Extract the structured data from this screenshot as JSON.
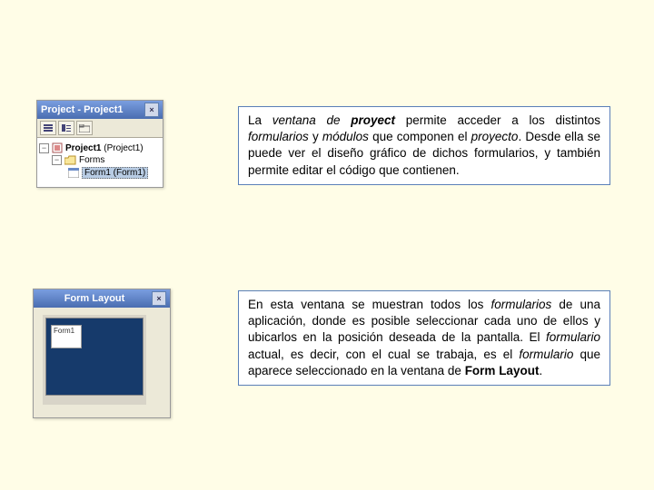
{
  "project_panel": {
    "title": "Project - Project1",
    "close_glyph": "×",
    "root_label_bold": "Project1",
    "root_label_suffix": " (Project1)",
    "folder_label": "Forms",
    "item_label": "Form1 (Form1)",
    "expander": "−"
  },
  "formlayout_panel": {
    "title": "Form Layout",
    "close_glyph": "×",
    "form_label": "Form1"
  },
  "desc1": {
    "t1": "La ",
    "t2": "ventana de ",
    "t3": "proyect",
    "t4": " permite acceder a los distintos ",
    "t5": "formularios",
    "t6": " y ",
    "t7": "módulos",
    "t8": " que componen el ",
    "t9": "proyecto",
    "t10": ". Desde ella se puede ver el diseño gráfico de dichos formularios, y también permite editar el código que contienen."
  },
  "desc2": {
    "t1": "En esta ventana se muestran todos los ",
    "t2": "formularios",
    "t3": " de una aplicación, donde es posible seleccionar cada uno de ellos y ubicarlos en la posición deseada de la pantalla. El ",
    "t4": "formulario",
    "t5": " actual, es decir, con el cual se trabaja, es el ",
    "t6": "formulario",
    "t7": " que aparece seleccionado en la ventana de ",
    "t8": "Form Layout",
    "t9": "."
  }
}
